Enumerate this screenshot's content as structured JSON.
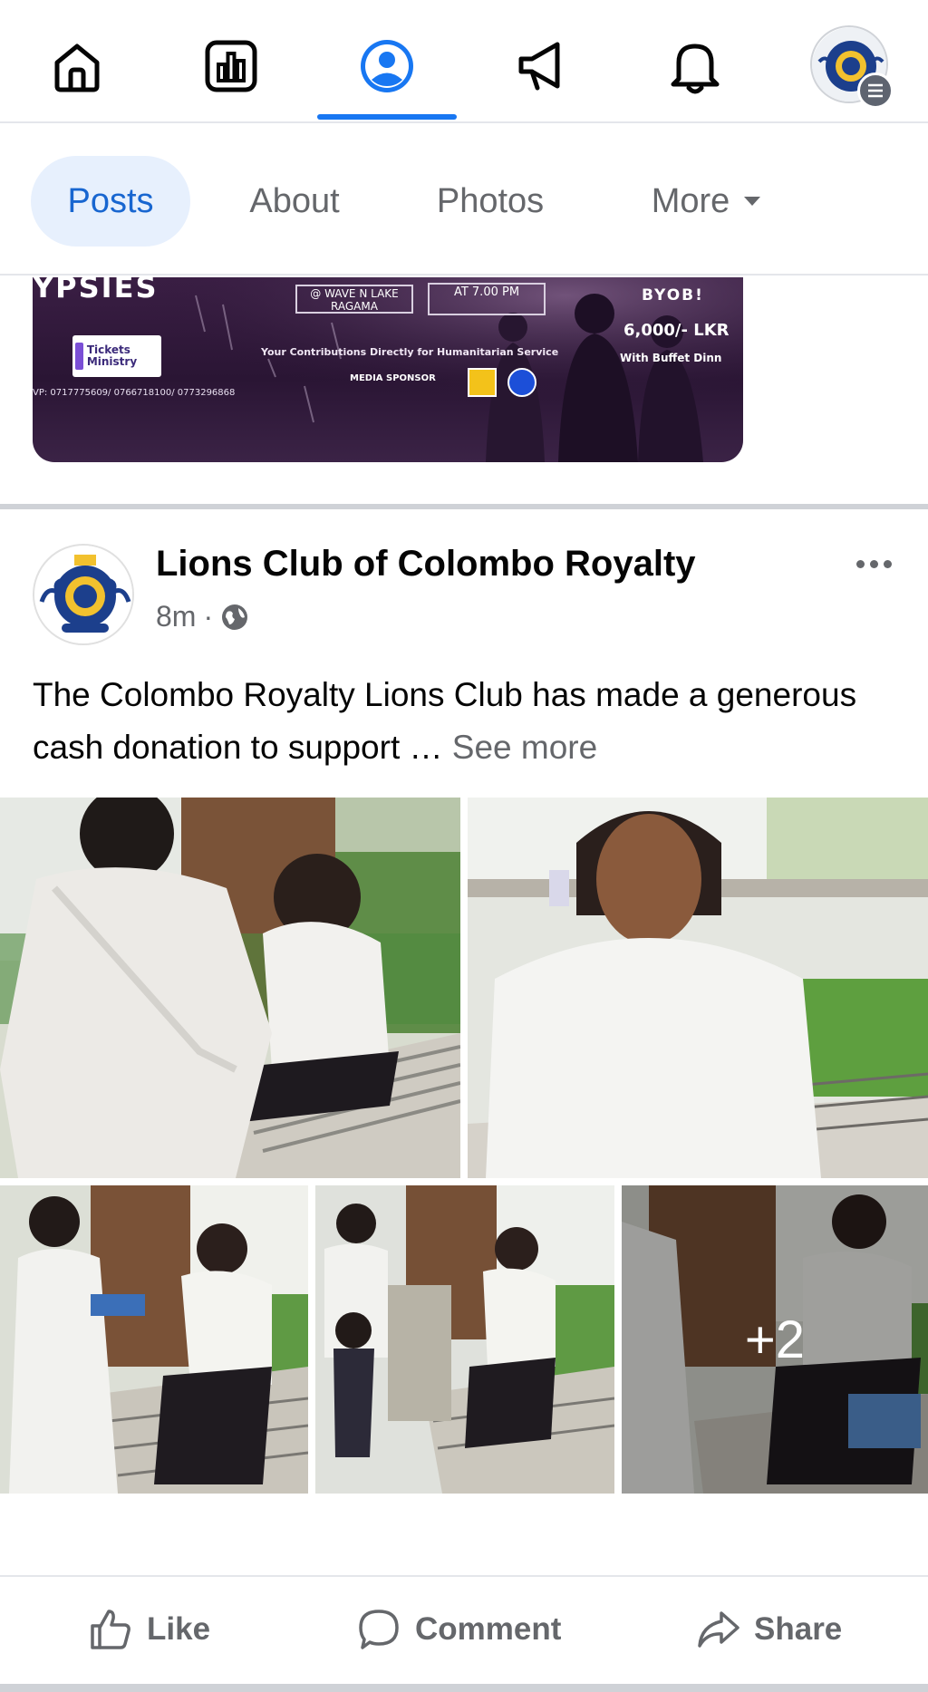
{
  "nav": {
    "icons": [
      "home-icon",
      "dashboard-icon",
      "profile-icon",
      "megaphone-icon",
      "bell-icon"
    ],
    "active": "profile-icon",
    "accent": "#1877f2"
  },
  "tabs": [
    {
      "label": "Posts",
      "active": true
    },
    {
      "label": "About",
      "active": false
    },
    {
      "label": "Photos",
      "active": false
    },
    {
      "label": "More",
      "active": false
    }
  ],
  "prev_post": {
    "banner_title": "YPSIES",
    "venue": "@ WAVE N LAKE RAGAMA",
    "time": "AT 7.00 PM",
    "byob": "BYOB!",
    "price": "6,000/- LKR",
    "buffet": "With Buffet Dinn",
    "tickets": "Tickets Ministry",
    "contributions": "Your Contributions Directly for Humanitarian Service",
    "media_sponsor": "MEDIA SPONSOR",
    "phones": "VP: 0717775609/ 0766718100/ 0773296868"
  },
  "post": {
    "page_name": "Lions Club of Colombo Royalty",
    "time": "8m",
    "privacy": "globe-icon",
    "text": "The Colombo Royalty Lions Club has made a generous cash donation to support …",
    "see_more": "See more",
    "extra_photos": "+2"
  },
  "actions": {
    "like": "Like",
    "comment": "Comment",
    "share": "Share"
  }
}
